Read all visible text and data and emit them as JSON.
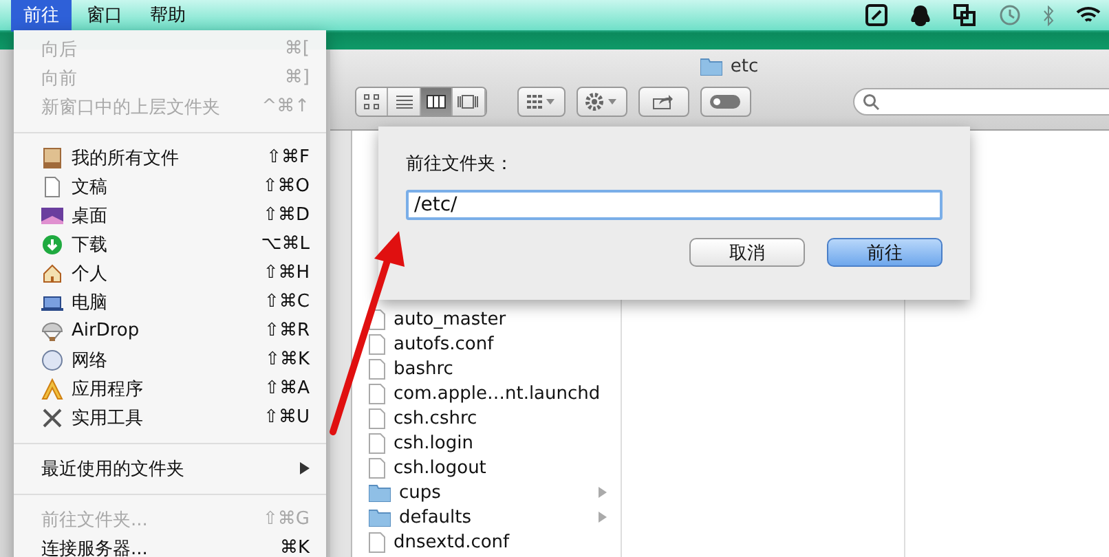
{
  "menubar": {
    "items": [
      {
        "label": "前往",
        "selected": true
      },
      {
        "label": "窗口",
        "selected": false
      },
      {
        "label": "帮助",
        "selected": false
      }
    ]
  },
  "go_menu": {
    "items": [
      {
        "kind": "item",
        "label": "向后",
        "shortcut": "⌘[",
        "disabled": true
      },
      {
        "kind": "item",
        "label": "向前",
        "shortcut": "⌘]",
        "disabled": true
      },
      {
        "kind": "item",
        "label": "新窗口中的上层文件夹",
        "shortcut": "^⌘↑",
        "disabled": true
      },
      {
        "kind": "separator"
      },
      {
        "kind": "item",
        "label": "我的所有文件",
        "shortcut": "⇧⌘F",
        "disabled": false
      },
      {
        "kind": "item",
        "label": "文稿",
        "shortcut": "⇧⌘O",
        "disabled": false
      },
      {
        "kind": "item",
        "label": "桌面",
        "shortcut": "⇧⌘D",
        "disabled": false
      },
      {
        "kind": "item",
        "label": "下载",
        "shortcut": "⌥⌘L",
        "disabled": false
      },
      {
        "kind": "item",
        "label": "个人",
        "shortcut": "⇧⌘H",
        "disabled": false
      },
      {
        "kind": "item",
        "label": "电脑",
        "shortcut": "⇧⌘C",
        "disabled": false
      },
      {
        "kind": "item",
        "label": "AirDrop",
        "shortcut": "⇧⌘R",
        "disabled": false
      },
      {
        "kind": "item",
        "label": "网络",
        "shortcut": "⇧⌘K",
        "disabled": false
      },
      {
        "kind": "item",
        "label": "应用程序",
        "shortcut": "⇧⌘A",
        "disabled": false
      },
      {
        "kind": "item",
        "label": "实用工具",
        "shortcut": "⇧⌘U",
        "disabled": false
      },
      {
        "kind": "separator"
      },
      {
        "kind": "submenu",
        "label": "最近使用的文件夹",
        "disabled": false
      },
      {
        "kind": "separator"
      },
      {
        "kind": "item",
        "label": "前往文件夹...",
        "shortcut": "⇧⌘G",
        "disabled": true
      },
      {
        "kind": "item",
        "label": "连接服务器...",
        "shortcut": "⌘K",
        "disabled": false
      }
    ]
  },
  "finder": {
    "title": "etc",
    "view_buttons": [
      {
        "kind": "icons",
        "selected": false
      },
      {
        "kind": "list",
        "selected": false
      },
      {
        "kind": "columns",
        "selected": true
      },
      {
        "kind": "coverflow",
        "selected": false
      }
    ],
    "files": [
      {
        "name": "auto_master",
        "kind": "file"
      },
      {
        "name": "autofs.conf",
        "kind": "file"
      },
      {
        "name": "bashrc",
        "kind": "file"
      },
      {
        "name": "com.apple…nt.launchd",
        "kind": "file"
      },
      {
        "name": "csh.cshrc",
        "kind": "file"
      },
      {
        "name": "csh.login",
        "kind": "file"
      },
      {
        "name": "csh.logout",
        "kind": "file"
      },
      {
        "name": "cups",
        "kind": "folder"
      },
      {
        "name": "defaults",
        "kind": "folder"
      },
      {
        "name": "dnsextd.conf",
        "kind": "file"
      }
    ]
  },
  "go_to_folder_dialog": {
    "label": "前往文件夹：",
    "value": "/etc/",
    "buttons": [
      {
        "label": "取消",
        "kind": "normal"
      },
      {
        "label": "前往",
        "kind": "default"
      }
    ]
  }
}
